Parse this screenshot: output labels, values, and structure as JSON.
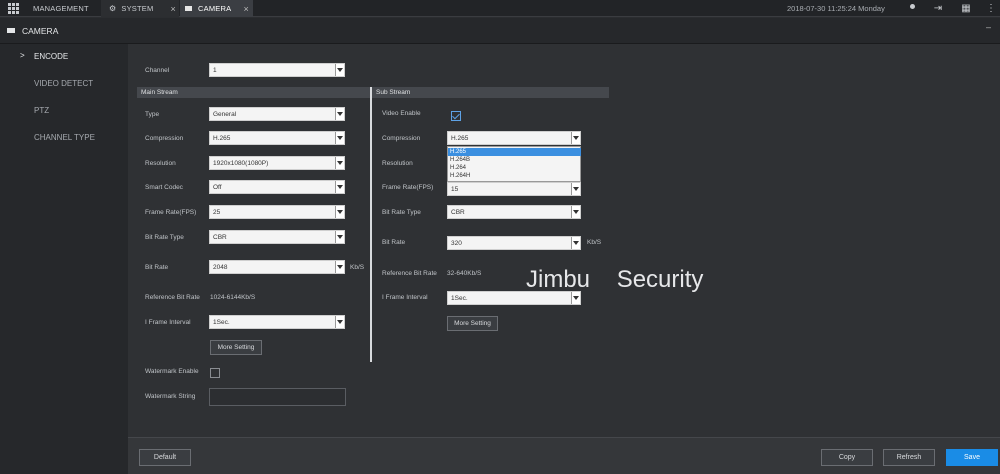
{
  "topbar": {
    "tabs": [
      {
        "label": "MANAGEMENT",
        "icon": "grid-icon"
      },
      {
        "label": "SYSTEM",
        "icon": "gears-icon"
      },
      {
        "label": "CAMERA",
        "icon": "camera-icon"
      }
    ],
    "datetime": "2018-07-30 11:25:24 Monday"
  },
  "page_title": "CAMERA",
  "sidebar": {
    "items": [
      {
        "label": "ENCODE",
        "marker": ">"
      },
      {
        "label": "VIDEO DETECT"
      },
      {
        "label": "PTZ"
      },
      {
        "label": "CHANNEL TYPE"
      }
    ]
  },
  "channel": {
    "label": "Channel",
    "value": "1"
  },
  "main_stream": {
    "header": "Main Stream",
    "type": {
      "label": "Type",
      "value": "General"
    },
    "compression": {
      "label": "Compression",
      "value": "H.265"
    },
    "resolution": {
      "label": "Resolution",
      "value": "1920x1080(1080P)"
    },
    "smart_codec": {
      "label": "Smart Codec",
      "value": "Off"
    },
    "frame_rate": {
      "label": "Frame Rate(FPS)",
      "value": "25"
    },
    "bit_rate_type": {
      "label": "Bit Rate Type",
      "value": "CBR"
    },
    "bit_rate": {
      "label": "Bit Rate",
      "value": "2048",
      "unit": "Kb/S"
    },
    "reference_bit_rate": {
      "label": "Reference Bit Rate",
      "value": "1024-6144Kb/S"
    },
    "i_frame_interval": {
      "label": "I Frame Interval",
      "value": "1Sec."
    },
    "more_setting": "More Setting"
  },
  "sub_stream": {
    "header": "Sub Stream",
    "video_enable": {
      "label": "Video Enable",
      "checked": true
    },
    "compression": {
      "label": "Compression",
      "value": "H.265",
      "options": [
        "H.265",
        "H.264B",
        "H.264",
        "H.264H"
      ],
      "highlighted": "H.265"
    },
    "resolution": {
      "label": "Resolution"
    },
    "frame_rate": {
      "label": "Frame Rate(FPS)",
      "value": "15"
    },
    "bit_rate_type": {
      "label": "Bit Rate Type",
      "value": "CBR"
    },
    "bit_rate": {
      "label": "Bit Rate",
      "value": "320",
      "unit": "Kb/S"
    },
    "reference_bit_rate": {
      "label": "Reference Bit Rate",
      "value": "32-640Kb/S"
    },
    "i_frame_interval": {
      "label": "I Frame Interval",
      "value": "1Sec."
    },
    "more_setting": "More Setting"
  },
  "watermark": {
    "enable_label": "Watermark Enable",
    "string_label": "Watermark String",
    "string_value": ""
  },
  "overlay_text": "Jimbu    Security",
  "footer": {
    "default": "Default",
    "copy": "Copy",
    "refresh": "Refresh",
    "save": "Save"
  },
  "colors": {
    "accent": "#1a8ce6",
    "highlight": "#3b8fe0"
  }
}
